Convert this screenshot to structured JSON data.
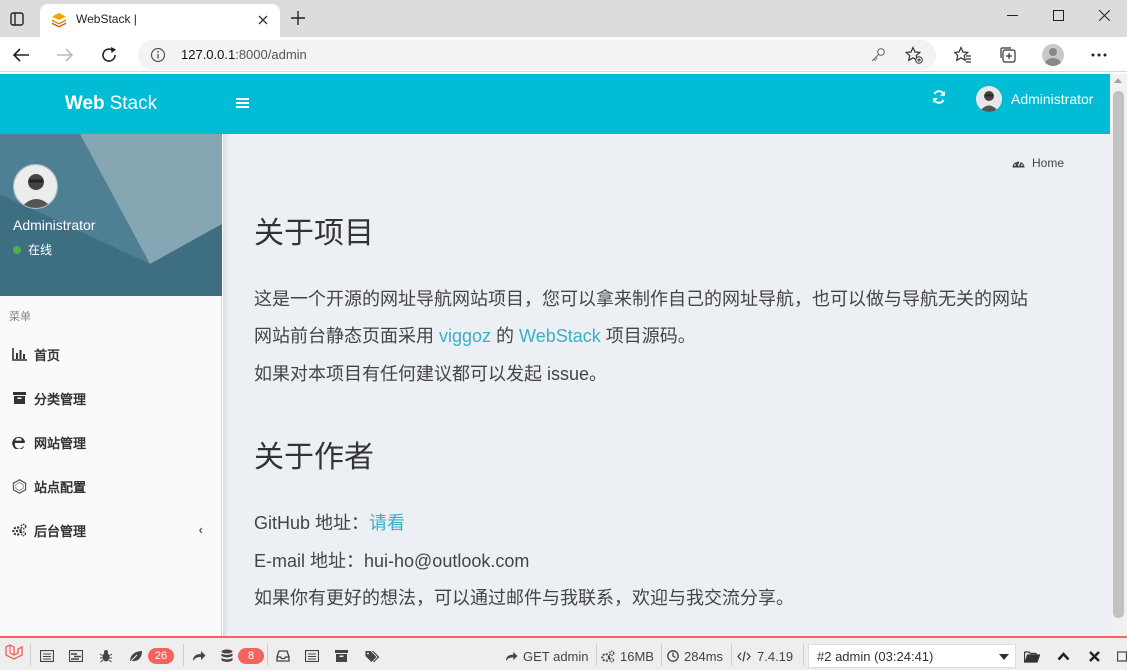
{
  "browser": {
    "tab_title": "WebStack |",
    "url_host": "127.0.0.1",
    "url_rest": ":8000/admin"
  },
  "header": {
    "logo_bold": "Web",
    "logo_regular": "Stack",
    "user_name": "Administrator"
  },
  "sidebar": {
    "user_name": "Administrator",
    "status": "在线",
    "menu_header": "菜单",
    "items": [
      {
        "label": "首页",
        "icon": "bar-chart-icon"
      },
      {
        "label": "分类管理",
        "icon": "archive-icon"
      },
      {
        "label": "网站管理",
        "icon": "edge-icon"
      },
      {
        "label": "站点配置",
        "icon": "hexagon-icon"
      },
      {
        "label": "后台管理",
        "icon": "cogs-icon",
        "has_arrow": true
      }
    ],
    "arrow": "‹"
  },
  "content": {
    "breadcrumb": "Home",
    "about_project": {
      "title": "关于项目",
      "line1": "这是一个开源的网址导航网站项目，您可以拿来制作自己的网址导航，也可以做与导航无关的网站",
      "line2_prefix": "网站前台静态页面采用 ",
      "line2_link1": "viggoz",
      "line2_mid": " 的 ",
      "line2_link2": "WebStack",
      "line2_suffix": " 项目源码。",
      "line3": "如果对本项目有任何建议都可以发起 issue。"
    },
    "about_author": {
      "title": "关于作者",
      "github_prefix": "GitHub 地址：",
      "github_link": "请看",
      "email": "E-mail 地址：hui-ho@outlook.com",
      "contact": "如果你有更好的想法，可以通过邮件与我联系，欢迎与我交流分享。"
    }
  },
  "debugbar": {
    "badge_logs": "26",
    "badge_queries": "8",
    "route": "GET admin",
    "memory": "16MB",
    "time": "284ms",
    "php_version": "7.4.19",
    "request_select": "#2 admin (03:24:41)"
  },
  "colors": {
    "accent": "#00bcd4",
    "link": "#3ab0c3",
    "debug_accent": "#f4645f"
  }
}
